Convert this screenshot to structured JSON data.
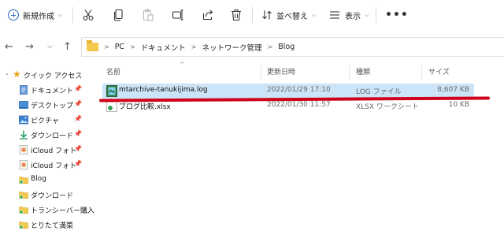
{
  "toolbar": {
    "new_label": "新規作成",
    "sort_label": "並べ替え",
    "view_label": "表示",
    "more_label": "•••",
    "icons": [
      "cut-icon",
      "copy-icon",
      "paste-icon",
      "rename-icon",
      "share-icon",
      "delete-icon"
    ]
  },
  "breadcrumb": [
    "PC",
    "ドキュメント",
    "ネットワーク管理",
    "Blog"
  ],
  "columns": {
    "name": "名前",
    "date": "更新日時",
    "type": "種類",
    "size": "サイズ"
  },
  "sidebar": {
    "items": [
      {
        "label": "クイック アクセス",
        "icon": "star-icon",
        "pinned": false
      },
      {
        "label": "ドキュメント",
        "icon": "documents-icon",
        "pinned": true
      },
      {
        "label": "デスクトップ",
        "icon": "desktop-icon",
        "pinned": true
      },
      {
        "label": "ピクチャ",
        "icon": "pictures-icon",
        "pinned": true
      },
      {
        "label": "ダウンロード",
        "icon": "download-icon",
        "pinned": true
      },
      {
        "label": "iCloud フォト",
        "icon": "icloud-icon",
        "pinned": true
      },
      {
        "label": "iCloud フォト",
        "icon": "icloud-icon",
        "pinned": true
      },
      {
        "label": "Blog",
        "icon": "folder-icon",
        "pinned": false
      },
      {
        "label": "ダウンロード",
        "icon": "folder-icon",
        "pinned": false
      },
      {
        "label": "トランシーバー購入",
        "icon": "folder-icon",
        "pinned": false
      },
      {
        "label": "とりたて満菜",
        "icon": "folder-icon",
        "pinned": false
      }
    ]
  },
  "files": [
    {
      "name": "mtarchive-tanukijima.log",
      "date": "2022/01/29 17:10",
      "type": "LOG ファイル",
      "size": "8,607 KB",
      "selected": true
    },
    {
      "name": "ブログ比較.xlsx",
      "date": "2022/01/30 11:57",
      "type": "XLSX ワークシート",
      "size": "10 KB",
      "selected": false
    }
  ],
  "colors": {
    "selection": "#cce4f7",
    "annotation": "#d0021b",
    "accent": "#2b6cc4"
  }
}
